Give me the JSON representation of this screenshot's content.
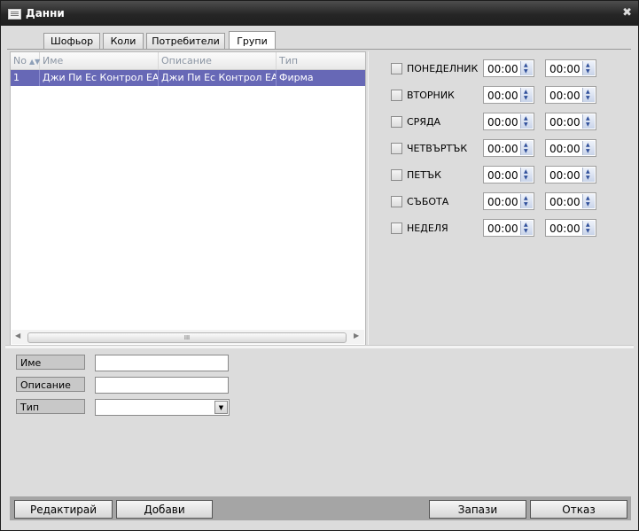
{
  "window": {
    "title": "Данни",
    "close_glyph": "✖"
  },
  "tabs": [
    {
      "label": "Шофьор",
      "active": false
    },
    {
      "label": "Коли",
      "active": false
    },
    {
      "label": "Потребители",
      "active": false
    },
    {
      "label": "Групи",
      "active": true
    }
  ],
  "grid": {
    "columns": [
      "No",
      "Име",
      "Описание",
      "Тип"
    ],
    "rows": [
      {
        "no": "1",
        "name": "Джи Пи Ес Контрол ЕАД",
        "description": "Джи Пи Ес Контрол ЕАД",
        "type": "Фирма"
      }
    ],
    "scroll_grip": "III"
  },
  "schedule": {
    "days": [
      {
        "label": "ПОНЕДЕЛНИК",
        "from": "00:00",
        "to": "00:00"
      },
      {
        "label": "ВТОРНИК",
        "from": "00:00",
        "to": "00:00"
      },
      {
        "label": "СРЯДА",
        "from": "00:00",
        "to": "00:00"
      },
      {
        "label": "ЧЕТВЪРТЪК",
        "from": "00:00",
        "to": "00:00"
      },
      {
        "label": "ПЕТЪК",
        "from": "00:00",
        "to": "00:00"
      },
      {
        "label": "СЪБОТА",
        "from": "00:00",
        "to": "00:00"
      },
      {
        "label": "НЕДЕЛЯ",
        "from": "00:00",
        "to": "00:00"
      }
    ]
  },
  "form": {
    "name_label": "Име",
    "name_value": "",
    "description_label": "Описание",
    "description_value": "",
    "type_label": "Тип",
    "type_value": ""
  },
  "buttons": {
    "edit": "Редактирай",
    "add": "Добави",
    "save": "Запази",
    "cancel": "Отказ"
  },
  "colors": {
    "selection": "#6768b6",
    "titlebar": "#262626",
    "panel": "#dcdcdc"
  }
}
